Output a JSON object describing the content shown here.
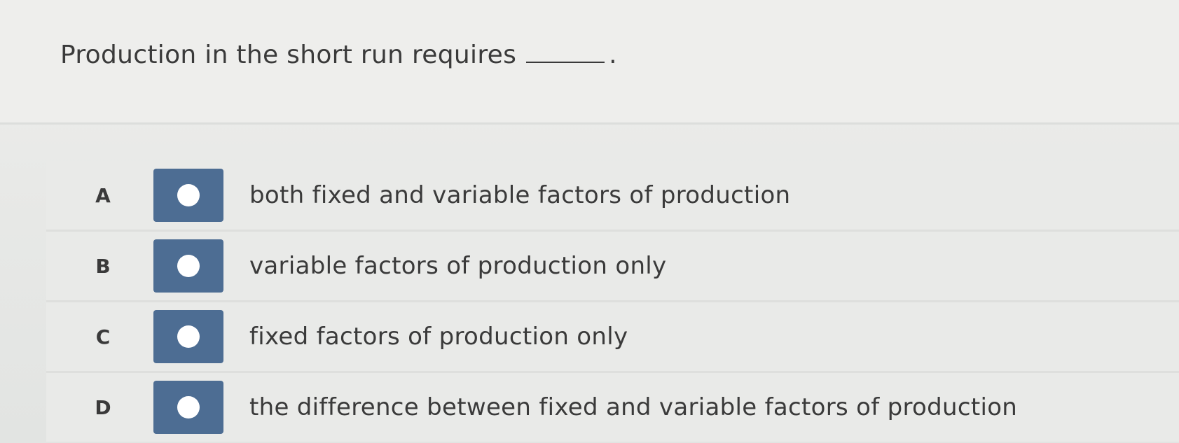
{
  "question": {
    "text": "Production in the short run requires",
    "end_punctuation": "."
  },
  "options": [
    {
      "letter": "A",
      "text": "both fixed and variable factors of production"
    },
    {
      "letter": "B",
      "text": "variable factors of production only"
    },
    {
      "letter": "C",
      "text": "fixed factors of production only"
    },
    {
      "letter": "D",
      "text": "the difference between fixed and variable factors of production"
    }
  ],
  "colors": {
    "radio_box": "#4d6d93",
    "radio_dot": "#ffffff",
    "text": "#3a3a3a",
    "background": "#ececea"
  }
}
